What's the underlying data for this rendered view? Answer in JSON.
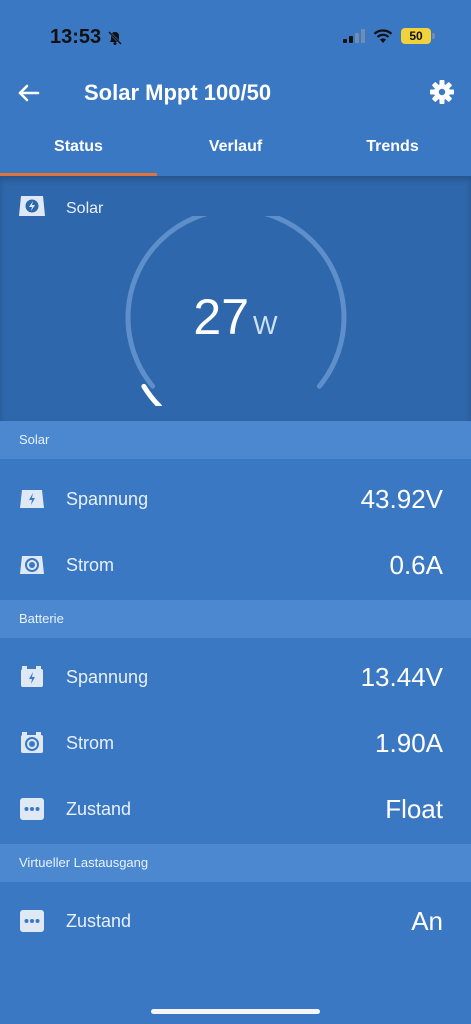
{
  "status_bar": {
    "time": "13:53",
    "battery": "50"
  },
  "app_bar": {
    "title": "Solar Mppt 100/50"
  },
  "tabs": [
    {
      "label": "Status",
      "active": true
    },
    {
      "label": "Verlauf",
      "active": false
    },
    {
      "label": "Trends",
      "active": false
    }
  ],
  "gauge": {
    "label": "Solar",
    "value": "27",
    "unit": "W",
    "level": 0.05
  },
  "sections": {
    "solar": {
      "header": "Solar",
      "rows": [
        {
          "label": "Spannung",
          "value": "43.92V",
          "icon": "bolt-icon"
        },
        {
          "label": "Strom",
          "value": "0.6A",
          "icon": "current-icon"
        }
      ]
    },
    "batterie": {
      "header": "Batterie",
      "rows": [
        {
          "label": "Spannung",
          "value": "13.44V",
          "icon": "battery-bolt-icon"
        },
        {
          "label": "Strom",
          "value": "1.90A",
          "icon": "current-icon"
        },
        {
          "label": "Zustand",
          "value": "Float",
          "icon": "dots-icon"
        }
      ]
    },
    "load": {
      "header": "Virtueller Lastausgang",
      "rows": [
        {
          "label": "Zustand",
          "value": "An",
          "icon": "dots-icon"
        }
      ]
    }
  },
  "colors": {
    "accent": "#e0733a",
    "background": "#3a78c4",
    "panel": "#2e67ab",
    "header": "#4b88cf"
  }
}
